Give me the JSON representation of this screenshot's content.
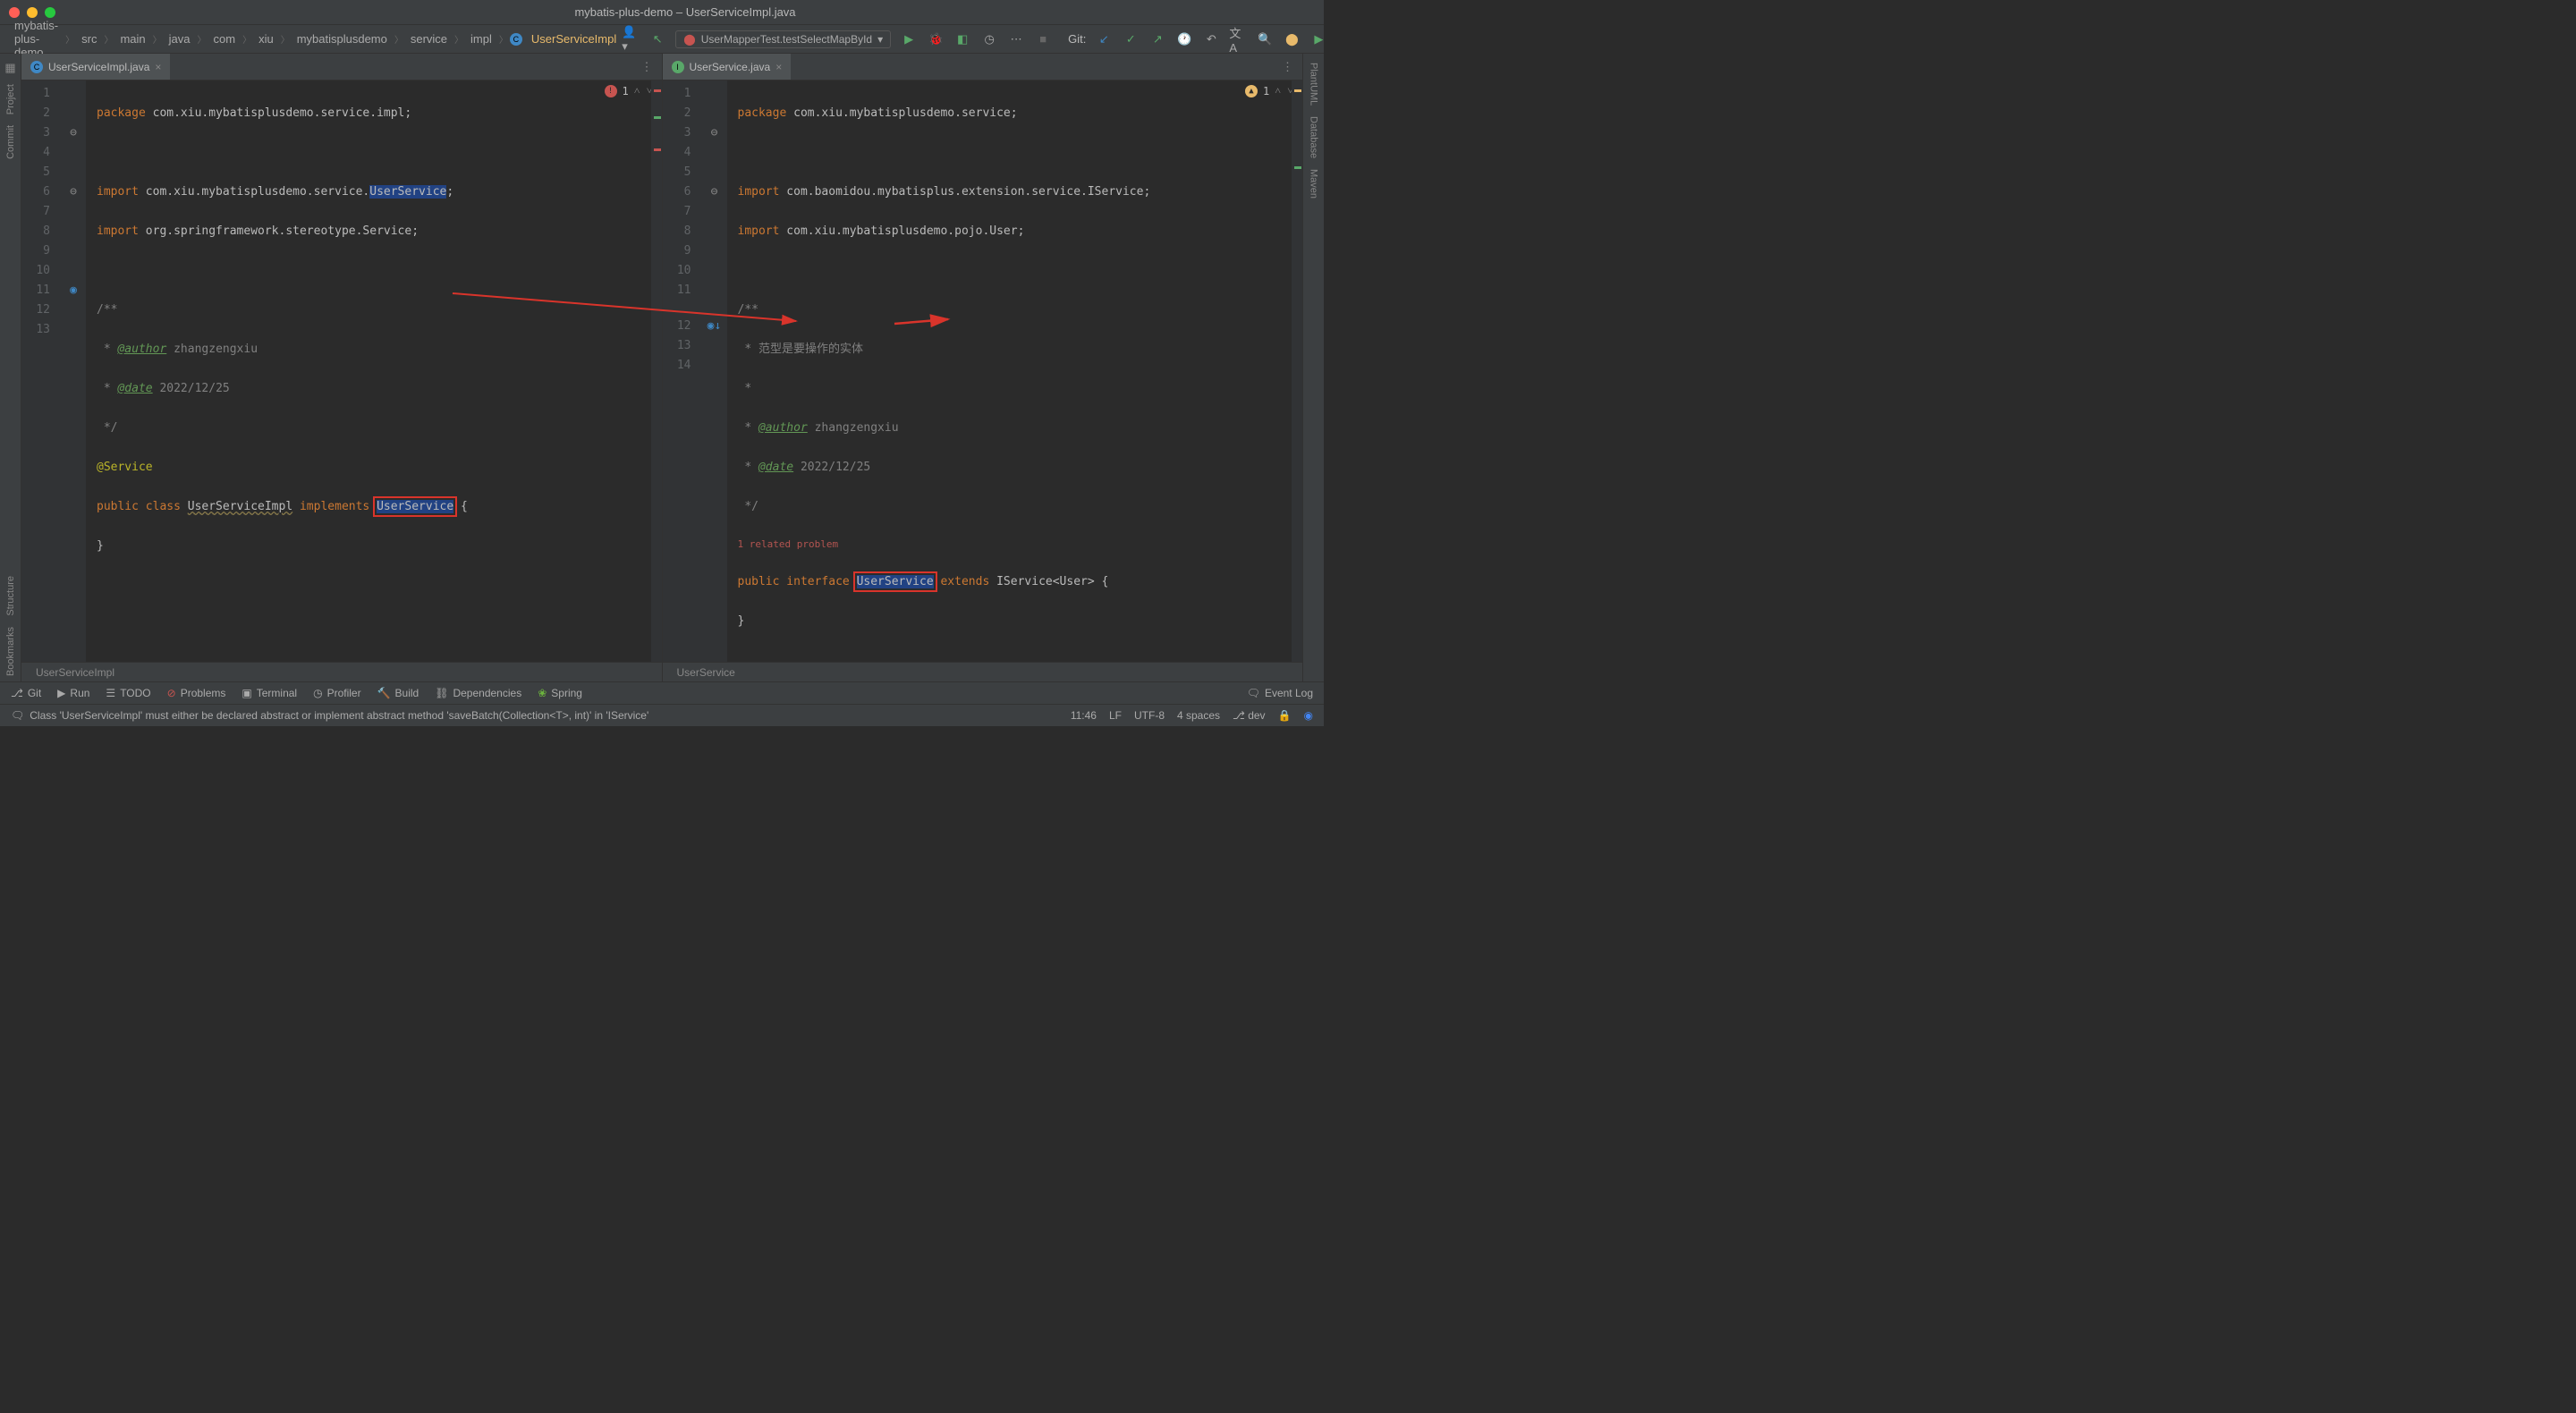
{
  "window_title": "mybatis-plus-demo – UserServiceImpl.java",
  "breadcrumbs": [
    "mybatis-plus-demo",
    "src",
    "main",
    "java",
    "com",
    "xiu",
    "mybatisplusdemo",
    "service",
    "impl",
    "UserServiceImpl"
  ],
  "run_config": "UserMapperTest.testSelectMapById",
  "git_label": "Git:",
  "left_tabs": {
    "left": {
      "filename": "UserServiceImpl.java",
      "breadcrumb_class": "UserServiceImpl"
    },
    "right": {
      "filename": "UserService.java",
      "breadcrumb_class": "UserService"
    }
  },
  "left_editor": {
    "error_count": "1",
    "lines": [
      "1",
      "2",
      "3",
      "4",
      "5",
      "6",
      "7",
      "8",
      "9",
      "10",
      "11",
      "12",
      "13"
    ],
    "code": {
      "l1_pkg": "package",
      "l1_path": " com.xiu.mybatisplusdemo.service.impl;",
      "l3_imp": "import",
      "l3_path": " com.xiu.mybatisplusdemo.service.",
      "l3_cls": "UserService",
      "l4_imp": "import",
      "l4_path": " org.springframework.stereotype.Service;",
      "l6_doc": "/**",
      "l7_a": " * ",
      "l7_tag": "@author",
      "l7_v": " zhangzengxiu",
      "l8_a": " * ",
      "l8_tag": "@date",
      "l8_v": " 2022/12/25",
      "l9_doc": " */",
      "l10": "@Service",
      "l11_pub": "public class ",
      "l11_cls": "UserServiceImpl",
      "l11_impl": " implements ",
      "l11_iface": "UserService",
      "l11_brace": " {",
      "l12": "}"
    }
  },
  "right_editor": {
    "warn_count": "1",
    "related_problems": "1 related problem",
    "lines": [
      "1",
      "2",
      "3",
      "4",
      "5",
      "6",
      "7",
      "8",
      "9",
      "10",
      "11",
      "",
      "12",
      "13",
      "14"
    ],
    "code": {
      "l1_pkg": "package",
      "l1_path": " com.xiu.mybatisplusdemo.service;",
      "l3_imp": "import",
      "l3_path": " com.baomidou.mybatisplus.extension.service.IService;",
      "l4_imp": "import",
      "l4_path": " com.xiu.mybatisplusdemo.pojo.User;",
      "l6_doc": "/**",
      "l7": " * 范型是要操作的实体",
      "l8": " *",
      "l9_a": " * ",
      "l9_tag": "@author",
      "l9_v": " zhangzengxiu",
      "l10_a": " * ",
      "l10_tag": "@date",
      "l10_v": " 2022/12/25",
      "l11_doc": " */",
      "l12_pub": "public interface ",
      "l12_cls": "UserService",
      "l12_ext": " extends ",
      "l12_ifc": "IService",
      "l12_gen": "<User> {",
      "l13": "}"
    }
  },
  "left_tools": [
    "Project",
    "Commit",
    "Structure",
    "Bookmarks"
  ],
  "right_tools": [
    "PlantUML",
    "Database",
    "Maven"
  ],
  "bottom": {
    "git": "Git",
    "run": "Run",
    "todo": "TODO",
    "problems": "Problems",
    "terminal": "Terminal",
    "profiler": "Profiler",
    "build": "Build",
    "deps": "Dependencies",
    "spring": "Spring",
    "eventlog": "Event Log"
  },
  "status": {
    "msg": "Class 'UserServiceImpl' must either be declared abstract or implement abstract method 'saveBatch(Collection<T>, int)' in 'IService'",
    "pos": "11:46",
    "sep": "LF",
    "enc": "UTF-8",
    "indent": "4 spaces",
    "branch": "dev"
  }
}
